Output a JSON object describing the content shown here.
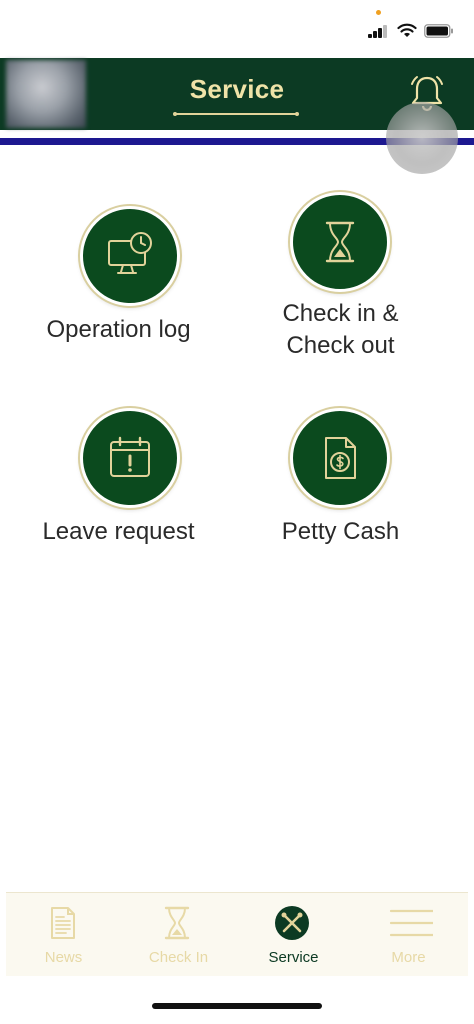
{
  "header": {
    "title": "Service"
  },
  "services": [
    {
      "label_lines": [
        "Operation log"
      ],
      "icon": "computer-clock-icon"
    },
    {
      "label_lines": [
        "Check in &",
        "Check out"
      ],
      "icon": "hourglass-icon"
    },
    {
      "label_lines": [
        "Leave request"
      ],
      "icon": "calendar-alert-icon"
    },
    {
      "label_lines": [
        "Petty Cash"
      ],
      "icon": "dollar-document-icon"
    }
  ],
  "bottom_nav": {
    "items": [
      {
        "label": "News",
        "icon": "news-icon",
        "active": false
      },
      {
        "label": "Check In",
        "icon": "hourglass-icon",
        "active": false
      },
      {
        "label": "Service",
        "icon": "tools-icon",
        "active": true
      },
      {
        "label": "More",
        "icon": "menu-icon",
        "active": false
      }
    ]
  },
  "colors": {
    "header_bg": "#0c3a23",
    "title_gold": "#efe3a8",
    "icon_circle": "#0b4a1e",
    "accent_blue": "#1d1890",
    "nav_inactive": "#e7d9a6",
    "nav_active": "#0c3a23"
  }
}
